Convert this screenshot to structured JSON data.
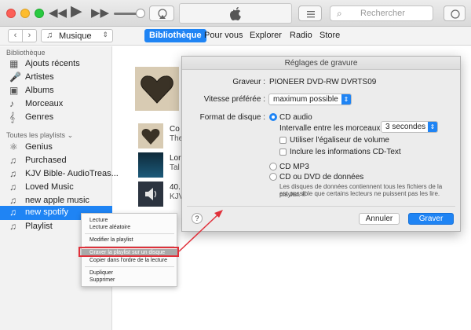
{
  "toolbar": {
    "search_placeholder": "Rechercher"
  },
  "nav": {
    "library_select": "Musique",
    "tabs": [
      "Bibliothèque",
      "Pour vous",
      "Explorer",
      "Radio",
      "Store"
    ]
  },
  "sidebar": {
    "library_heading": "Bibliothèque",
    "library_items": [
      {
        "label": "Ajouts récents",
        "icon": "grid-icon"
      },
      {
        "label": "Artistes",
        "icon": "microphone-icon"
      },
      {
        "label": "Albums",
        "icon": "album-icon"
      },
      {
        "label": "Morceaux",
        "icon": "music-note-icon"
      },
      {
        "label": "Genres",
        "icon": "genres-icon"
      }
    ],
    "playlists_heading": "Toutes les playlists",
    "playlists": [
      {
        "label": "Genius",
        "icon": "genius-icon"
      },
      {
        "label": "Purchased",
        "icon": "playlist-icon"
      },
      {
        "label": "KJV Bible- AudioTreas...",
        "icon": "playlist-icon"
      },
      {
        "label": "Loved Music",
        "icon": "playlist-icon"
      },
      {
        "label": "new apple music",
        "icon": "playlist-icon"
      },
      {
        "label": "new spotify",
        "icon": "playlist-icon",
        "selected": true
      },
      {
        "label": "Playlist",
        "icon": "playlist-icon"
      }
    ]
  },
  "content": {
    "rows": [
      {
        "line1": "Co",
        "line2": "The"
      },
      {
        "line1": "Lor",
        "line2": "Tal"
      },
      {
        "line1": "40.",
        "line2": "KJV"
      }
    ]
  },
  "dialog": {
    "title": "Réglages de gravure",
    "burner_label": "Graveur :",
    "burner_value": "PIONEER DVD-RW  DVRTS09",
    "speed_label": "Vitesse préférée :",
    "speed_value": "maximum possible",
    "format_label": "Format de disque :",
    "audio_cd": "CD audio",
    "gap_label": "Intervalle entre les morceaux :",
    "gap_value": "3 secondes",
    "eq_check": "Utiliser l'égaliseur de volume",
    "cdtext_check": "Inclure les informations CD-Text",
    "mp3_cd": "CD MP3",
    "data_cd": "CD ou DVD de données",
    "data_note_1": "Les disques de données contiennent tous les fichiers de la playlist. Il",
    "data_note_2": "est possible que certains lecteurs ne puissent pas les lire.",
    "help": "?",
    "cancel": "Annuler",
    "ok": "Graver"
  },
  "context_menu": {
    "items": [
      "Lecture",
      "Lecture aléatoire",
      "Modifier la playlist",
      "Graver la playlist sur un disque",
      "Copier dans l'ordre de la lecture",
      "Dupliquer",
      "Supprimer"
    ]
  },
  "colors": {
    "accent": "#1f84f4",
    "annotation": "#e0303a"
  }
}
